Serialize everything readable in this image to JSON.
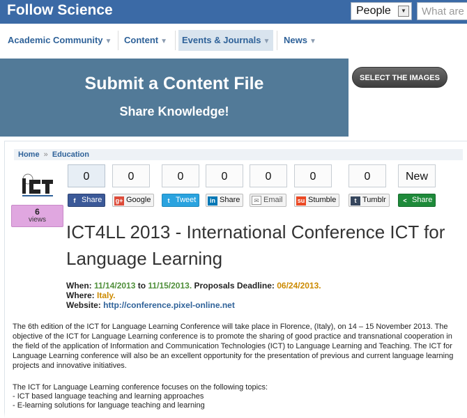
{
  "header": {
    "brand": "Follow Science",
    "scope_select": "People",
    "search_placeholder": "What are"
  },
  "nav": [
    {
      "label": "Academic Community"
    },
    {
      "label": "Content"
    },
    {
      "label": "Events & Journals"
    },
    {
      "label": "News"
    }
  ],
  "banner": {
    "title": "Submit a Content File",
    "subtitle": "Share Knowledge!",
    "select_images": "SELECT THE IMAGES"
  },
  "breadcrumb": {
    "home": "Home",
    "separator": "»",
    "category": "Education"
  },
  "views": {
    "count": "6",
    "label": "views"
  },
  "share": {
    "counts": [
      "0",
      "0",
      "0",
      "0",
      "0",
      "0",
      "0",
      "New"
    ],
    "buttons": [
      {
        "label": "Share",
        "icon": "f"
      },
      {
        "label": "Google",
        "icon": "g+"
      },
      {
        "label": "Tweet",
        "icon": "t"
      },
      {
        "label": "Share",
        "icon": "in"
      },
      {
        "label": "Email",
        "icon": "✉"
      },
      {
        "label": "Stumble",
        "icon": "su"
      },
      {
        "label": "Tumblr",
        "icon": "t"
      },
      {
        "label": "Share",
        "icon": "<"
      }
    ]
  },
  "event": {
    "title": "ICT4LL 2013 - International Conference ICT for Language Learning",
    "when_label": "When:",
    "start": "11/14/2013",
    "to": "to",
    "end": "11/15/2013.",
    "deadline_label": "Proposals Deadline:",
    "deadline": "06/24/2013.",
    "where_label": "Where:",
    "where": "Italy.",
    "website_label": "Website:",
    "website": "http://conference.pixel-online.net"
  },
  "description": "The 6th edition of the ICT for Language Learning Conference will take place in Florence, (Italy), on 14 – 15 November 2013. The objective of the ICT for Language Learning conference is to promote the sharing of good practice and transnational cooperation in the field of the application of Information and Communication Technologies (ICT) to Language Learning and Teaching. The ICT for Language Learning conference will also be an excellent opportunity for the presentation of previous and current language learning projects and innovative initiatives.",
  "topics": {
    "intro": "The ICT for Language Learning conference focuses on the following topics:",
    "items": [
      "- ICT based language teaching and learning approaches",
      "- E-learning solutions for language teaching and learning"
    ]
  }
}
